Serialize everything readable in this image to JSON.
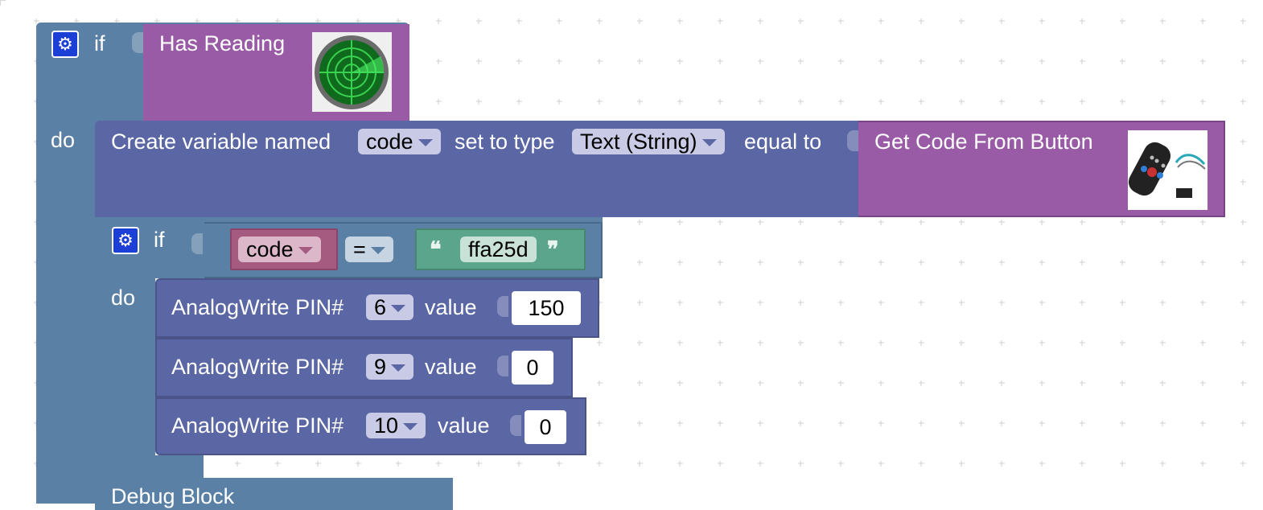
{
  "colors": {
    "control": "#5b80a5",
    "sensor": "#995ba5",
    "variable_block": "#5b67a5",
    "variable_get": "#a55b80",
    "string": "#5ba58c",
    "compare": "#5b80a5",
    "gear": "#1c3fd6"
  },
  "if_outer": {
    "if_label": "if",
    "do_label": "do",
    "gear_icon": "gear-icon"
  },
  "has_reading": {
    "label": "Has Reading",
    "image": "radar-sensor-image"
  },
  "create_var": {
    "prefix": "Create variable named",
    "var_name": "code",
    "mid": "set to type",
    "type": "Text (String)",
    "suffix": "equal to"
  },
  "get_code": {
    "label": "Get Code From Button",
    "image": "ir-remote-image"
  },
  "if_inner": {
    "if_label": "if",
    "do_label": "do",
    "var": "code",
    "operator": "=",
    "open_quote": "❝",
    "close_quote": "❞",
    "string_value": "ffa25d"
  },
  "analog_writes": [
    {
      "label": "AnalogWrite PIN#",
      "pin": "6",
      "value_label": "value",
      "value": "150"
    },
    {
      "label": "AnalogWrite PIN#",
      "pin": "9",
      "value_label": "value",
      "value": "0"
    },
    {
      "label": "AnalogWrite PIN#",
      "pin": "10",
      "value_label": "value",
      "value": "0"
    }
  ],
  "debug_block": {
    "label": "Debug Block"
  }
}
